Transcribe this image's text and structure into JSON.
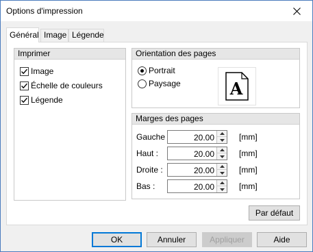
{
  "window": {
    "title": "Options d'impression"
  },
  "tabs": [
    {
      "label": "Général"
    },
    {
      "label": "Image"
    },
    {
      "label": "Légende"
    }
  ],
  "print_group": {
    "title": "Imprimer",
    "items": [
      {
        "label": "Image",
        "checked": true
      },
      {
        "label": "Échelle de couleurs",
        "checked": true
      },
      {
        "label": "Légende",
        "checked": true
      }
    ]
  },
  "orientation_group": {
    "title": "Orientation des pages",
    "options": [
      {
        "label": "Portrait",
        "selected": true
      },
      {
        "label": "Paysage",
        "selected": false
      }
    ],
    "preview_glyph": "A"
  },
  "margins_group": {
    "title": "Marges des pages",
    "unit": "[mm]",
    "rows": [
      {
        "label": "Gauche",
        "value": "20.00"
      },
      {
        "label": "Haut :",
        "value": "20.00"
      },
      {
        "label": "Droite :",
        "value": "20.00"
      },
      {
        "label": "Bas :",
        "value": "20.00"
      }
    ]
  },
  "buttons": {
    "defaults": "Par défaut",
    "ok": "OK",
    "cancel": "Annuler",
    "apply": "Appliquer",
    "help": "Aide"
  },
  "colors": {
    "accent": "#0078d7",
    "border": "#c8c8c8",
    "header": "#e6e6e6"
  }
}
